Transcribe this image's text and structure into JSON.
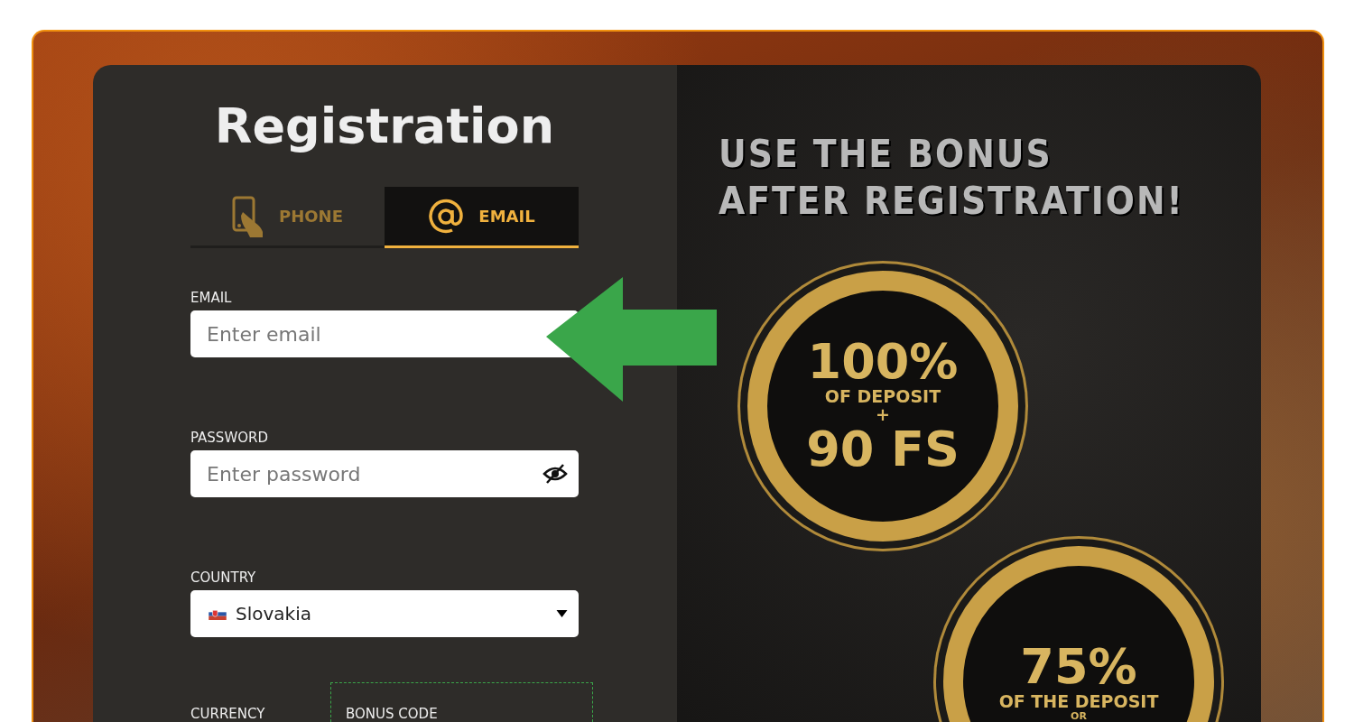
{
  "title": "Registration",
  "tabs": [
    {
      "label": "PHONE",
      "kind": "phone",
      "selected": false
    },
    {
      "label": "EMAIL",
      "kind": "email",
      "selected": true
    }
  ],
  "fields": [
    {
      "label": "EMAIL",
      "kind": "text",
      "placeholder": "Enter email"
    },
    {
      "label": "PASSWORD",
      "kind": "password",
      "placeholder": "Enter password"
    },
    {
      "label": "COUNTRY",
      "kind": "select",
      "value": "Slovakia"
    }
  ],
  "currency": {
    "label": "CURRENCY"
  },
  "bonus_code": {
    "label": "BONUS CODE"
  },
  "promo": {
    "heading": [
      "USE THE BONUS",
      "AFTER REGISTRATION!"
    ],
    "offers": [
      {
        "lines": [
          {
            "text": "100%",
            "kind": "big"
          },
          {
            "text": "OF DEPOSIT",
            "kind": "small"
          },
          {
            "text": "+",
            "kind": "small"
          },
          {
            "text": "90 FS",
            "kind": "big"
          }
        ]
      },
      {
        "lines": [
          {
            "text": "75%",
            "kind": "big"
          },
          {
            "text": "OF THE DEPOSIT",
            "kind": "small"
          },
          {
            "text": "OR",
            "kind": "tiny"
          }
        ]
      }
    ]
  }
}
